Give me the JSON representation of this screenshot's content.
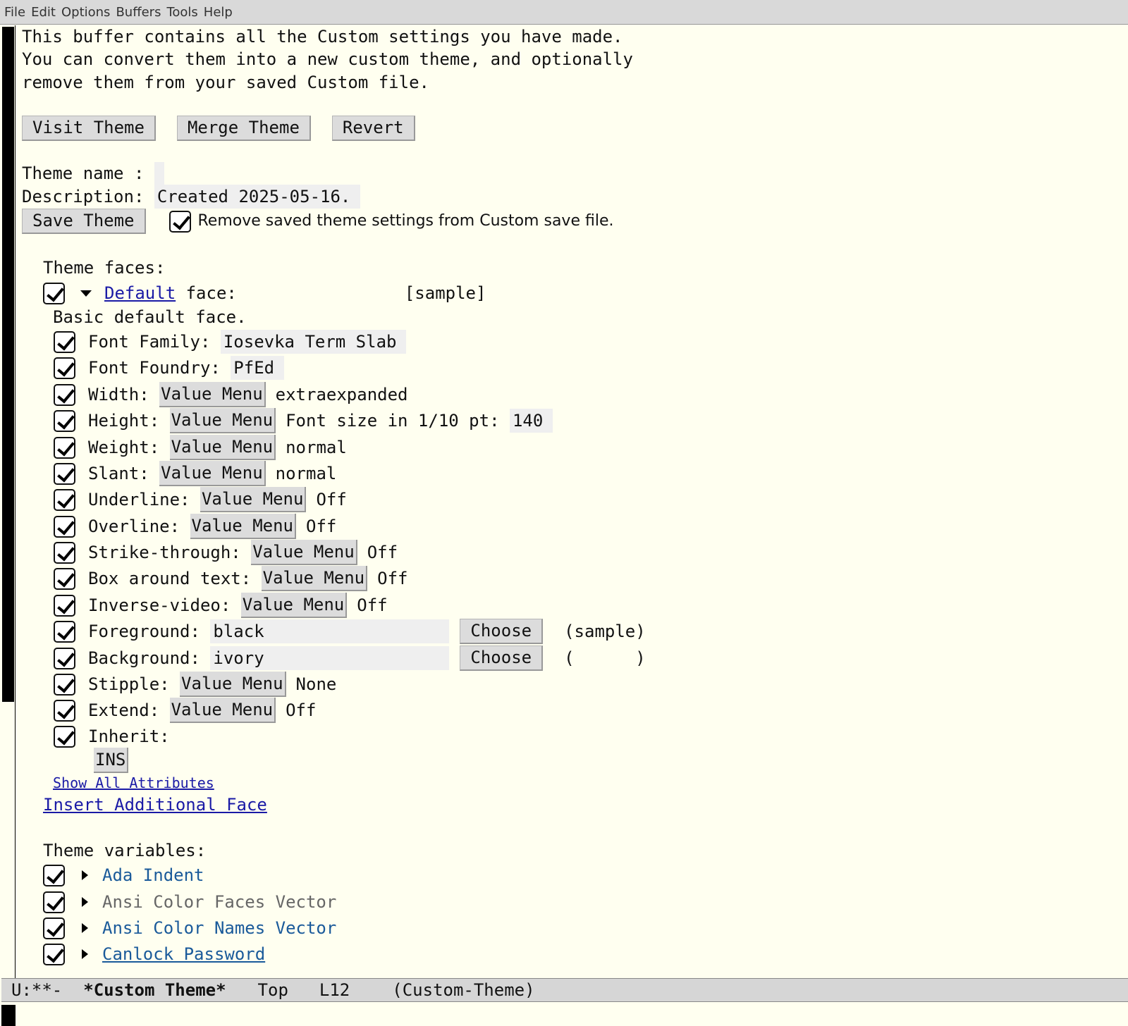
{
  "menubar": [
    "File",
    "Edit",
    "Options",
    "Buffers",
    "Tools",
    "Help"
  ],
  "intro": [
    "This buffer contains all the Custom settings you have made.",
    "You can convert them into a new custom theme, and optionally",
    "remove them from your saved Custom file."
  ],
  "buttons": {
    "visit": "Visit Theme",
    "merge": "Merge Theme",
    "revert": "Revert",
    "save": "Save Theme"
  },
  "theme_name_label": "Theme name : ",
  "theme_name_value": "",
  "description_label": "Description: ",
  "description_value": "Created 2025-05-16.",
  "remove_saved_label": "Remove saved theme settings from Custom save file.",
  "theme_faces_label": "Theme faces:",
  "default_face": {
    "link": "Default",
    "label": " face:",
    "sample": "[sample]",
    "doc": "Basic default face."
  },
  "value_menu_label": "Value Menu",
  "attributes": {
    "font_family": {
      "label": "Font Family: ",
      "value": "Iosevka Term Slab"
    },
    "font_foundry": {
      "label": "Font Foundry: ",
      "value": "PfEd"
    },
    "width": {
      "label": "Width: ",
      "value": "extraexpanded"
    },
    "height": {
      "label": "Height: ",
      "extra": "Font size in 1/10 pt: ",
      "value": "140"
    },
    "weight": {
      "label": "Weight: ",
      "value": "normal"
    },
    "slant": {
      "label": "Slant: ",
      "value": "normal"
    },
    "underline": {
      "label": "Underline: ",
      "value": "Off"
    },
    "overline": {
      "label": "Overline: ",
      "value": "Off"
    },
    "strike": {
      "label": "Strike-through: ",
      "value": "Off"
    },
    "box": {
      "label": "Box around text: ",
      "value": "Off"
    },
    "inverse": {
      "label": "Inverse-video: ",
      "value": "Off"
    },
    "foreground": {
      "label": "Foreground: ",
      "value": "black",
      "button": "Choose",
      "sample": "(sample)"
    },
    "background": {
      "label": "Background: ",
      "value": "ivory",
      "button": "Choose",
      "sample": "(      )"
    },
    "stipple": {
      "label": "Stipple: ",
      "value": "None"
    },
    "extend": {
      "label": "Extend: ",
      "value": "Off"
    },
    "inherit": {
      "label": "Inherit:",
      "ins": "INS"
    }
  },
  "show_all_attributes": "Show All Attributes",
  "insert_additional_face": "Insert Additional Face",
  "theme_variables_label": "Theme variables:",
  "variables": [
    "Ada Indent",
    "Ansi Color Faces Vector",
    "Ansi Color Names Vector",
    "Canlock Password"
  ],
  "modeline": {
    "status": "U:**-",
    "buffer": "*Custom Theme*",
    "position": "Top",
    "line": "L12",
    "mode": "(Custom-Theme)"
  }
}
